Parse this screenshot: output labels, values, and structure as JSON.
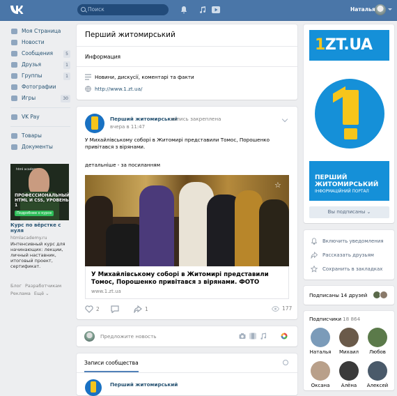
{
  "topbar": {
    "search_placeholder": "Поиск",
    "user_name": "Наталья",
    "accent": "#4a76a8"
  },
  "leftnav": {
    "items": [
      {
        "label": "Моя Страница",
        "icon": "home-icon",
        "badge": ""
      },
      {
        "label": "Новости",
        "icon": "news-icon",
        "badge": ""
      },
      {
        "label": "Сообщения",
        "icon": "messages-icon",
        "badge": "5"
      },
      {
        "label": "Друзья",
        "icon": "friends-icon",
        "badge": "1"
      },
      {
        "label": "Группы",
        "icon": "groups-icon",
        "badge": "1"
      },
      {
        "label": "Фотографии",
        "icon": "photos-icon",
        "badge": ""
      },
      {
        "label": "Игры",
        "icon": "games-icon",
        "badge": "30"
      },
      {
        "label": "VK Pay",
        "icon": "vkpay-icon",
        "badge": ""
      },
      {
        "label": "Товары",
        "icon": "goods-icon",
        "badge": ""
      },
      {
        "label": "Документы",
        "icon": "documents-icon",
        "badge": ""
      }
    ],
    "ad": {
      "brand": "html academy",
      "image_text": "ПРОФЕССИОНАЛЬНЫЙ HTML И CSS, УРОВЕНЬ 1",
      "image_button": "Подробнее о курсе",
      "title": "Курс по вёрстке с нуля",
      "site": "htmlacademy.ru",
      "description": "Интенсивный курс для начинающих: лекции, личный наставник, итоговый проект, сертификат."
    },
    "footer": [
      "Блог",
      "Разработчикам",
      "Реклама",
      "Ещё ⌄"
    ]
  },
  "page_header": {
    "title": "Перший житомирський",
    "info_label": "Информация",
    "description": "Новини, дискусії, коментарі та факти",
    "website": "http://www.1.zt.ua/"
  },
  "post": {
    "author": "Перший житомирський",
    "pinned": "запись закреплена",
    "date": "вчера в 11:47",
    "text": "У Михайлівському соборі в Житомирі представили Томос, Порошенко привітався з вірянами.",
    "more": "детальніше - за посиланням",
    "link_title": "У Михайлівському соборі в Житомирі представили Томос, Порошенко привітався з вірянами. ФОТО",
    "link_site": "www.1.zt.ua",
    "likes": "2",
    "shares": "1",
    "views": "177"
  },
  "compose": {
    "placeholder": "Предложите новость"
  },
  "wall": {
    "tab": "Записи сообщества",
    "author": "Перший житомирський"
  },
  "cover": {
    "logo_prefix": "1",
    "logo_rest": "ZT.UA",
    "name": "ПЕРШИЙ ЖИТОМИРСЬКИЙ",
    "subtitle": "ІНФОРМАЦІЙНИЙ ПОРТАЛ",
    "subscribed": "Вы подписаны ⌄",
    "brand_blue": "#1590d8",
    "brand_yellow": "#f6c51b"
  },
  "actions": [
    {
      "label": "Включить уведомления",
      "icon": "bell-icon"
    },
    {
      "label": "Рассказать друзьям",
      "icon": "share-icon"
    },
    {
      "label": "Сохранить в закладках",
      "icon": "star-icon"
    }
  ],
  "friends": {
    "label": "Подписаны 14 друзей"
  },
  "subscribers": {
    "label": "Подписчики",
    "count": "18 864",
    "people": [
      {
        "name": "Наталья",
        "color": "#7b9bb9"
      },
      {
        "name": "Михаил",
        "color": "#6a5a4a"
      },
      {
        "name": "Любов",
        "color": "#5b7a4a"
      },
      {
        "name": "Оксана",
        "color": "#b9a08a"
      },
      {
        "name": "Алёна",
        "color": "#3a3a3a"
      },
      {
        "name": "Алексей",
        "color": "#4a5a6a"
      }
    ]
  }
}
